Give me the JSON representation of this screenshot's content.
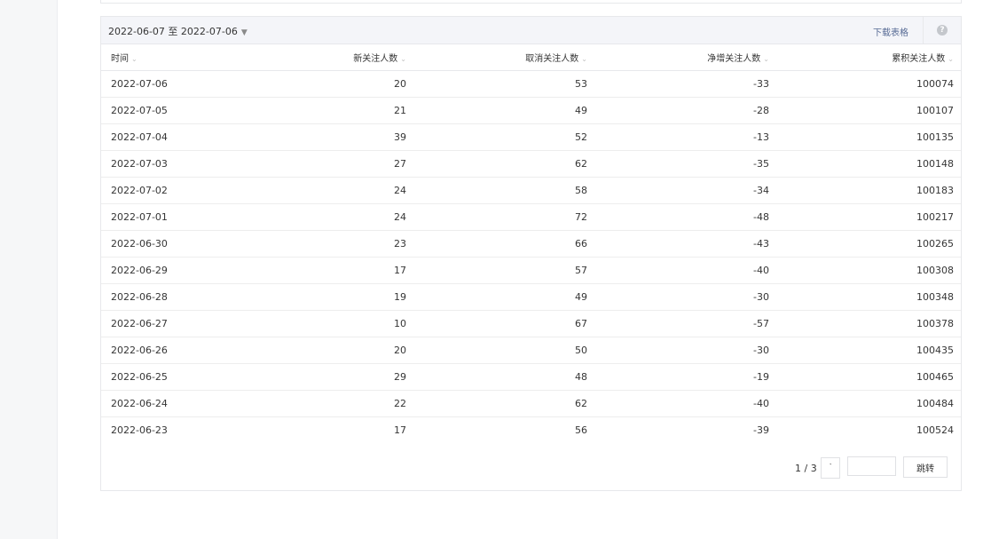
{
  "date_range": {
    "label": "2022-06-07 至 2022-07-06",
    "arrow": "▼"
  },
  "download_label": "下载表格",
  "help_icon": "?",
  "sort_icon": "⌄",
  "columns": [
    "时间",
    "新关注人数",
    "取消关注人数",
    "净增关注人数",
    "累积关注人数"
  ],
  "rows": [
    [
      "2022-07-06",
      "20",
      "53",
      "-33",
      "100074"
    ],
    [
      "2022-07-05",
      "21",
      "49",
      "-28",
      "100107"
    ],
    [
      "2022-07-04",
      "39",
      "52",
      "-13",
      "100135"
    ],
    [
      "2022-07-03",
      "27",
      "62",
      "-35",
      "100148"
    ],
    [
      "2022-07-02",
      "24",
      "58",
      "-34",
      "100183"
    ],
    [
      "2022-07-01",
      "24",
      "72",
      "-48",
      "100217"
    ],
    [
      "2022-06-30",
      "23",
      "66",
      "-43",
      "100265"
    ],
    [
      "2022-06-29",
      "17",
      "57",
      "-40",
      "100308"
    ],
    [
      "2022-06-28",
      "19",
      "49",
      "-30",
      "100348"
    ],
    [
      "2022-06-27",
      "10",
      "67",
      "-57",
      "100378"
    ],
    [
      "2022-06-26",
      "20",
      "50",
      "-30",
      "100435"
    ],
    [
      "2022-06-25",
      "29",
      "48",
      "-19",
      "100465"
    ],
    [
      "2022-06-24",
      "22",
      "62",
      "-40",
      "100484"
    ],
    [
      "2022-06-23",
      "17",
      "56",
      "-39",
      "100524"
    ]
  ],
  "pagination": {
    "info": "1 / 3",
    "next_icon": "˺",
    "jump_label": "跳转",
    "input_value": ""
  }
}
